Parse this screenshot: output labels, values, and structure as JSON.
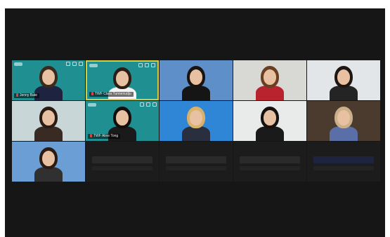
{
  "meeting": {
    "title": "",
    "participants": [
      {
        "id": "p1",
        "name": "Jenny Bate",
        "bg": "#1f8f91",
        "hair": "#3a2a1e",
        "top": "#1e2440",
        "has_name": true,
        "has_icons": true,
        "active": false
      },
      {
        "id": "p2",
        "name": "TWF Clara Tunnenudju",
        "bg": "#1f8f91",
        "hair": "#2a1e16",
        "top": "#f3f3f3",
        "has_name": true,
        "has_icons": true,
        "active": true
      },
      {
        "id": "p3",
        "name": "",
        "bg": "#5f8fc9",
        "hair": "#1a1410",
        "top": "#151515",
        "has_name": false,
        "has_icons": false,
        "active": false
      },
      {
        "id": "p4",
        "name": "",
        "bg": "#d8d8d4",
        "hair": "#6a3e22",
        "top": "#b8232e",
        "has_name": false,
        "has_icons": false,
        "active": false
      },
      {
        "id": "p5",
        "name": "",
        "bg": "#e3e6e8",
        "hair": "#1e1612",
        "top": "#242424",
        "has_name": false,
        "has_icons": false,
        "active": false
      },
      {
        "id": "p6",
        "name": "",
        "bg": "#c9d6d8",
        "hair": "#2a1c14",
        "top": "#3a2a24",
        "has_name": false,
        "has_icons": false,
        "active": false
      },
      {
        "id": "p7",
        "name": "TWF Aline Tong",
        "bg": "#1f8f91",
        "hair": "#120e0c",
        "top": "#1a1a1a",
        "has_name": true,
        "has_icons": true,
        "active": false
      },
      {
        "id": "p8",
        "name": "",
        "bg": "#2f86d6",
        "hair": "#d9b26a",
        "top": "#2a2f40",
        "has_name": false,
        "has_icons": false,
        "active": false
      },
      {
        "id": "p9",
        "name": "",
        "bg": "#e9eaea",
        "hair": "#161210",
        "top": "#1a1a1a",
        "has_name": false,
        "has_icons": false,
        "active": false
      },
      {
        "id": "p10",
        "name": "",
        "bg": "#4b3a2e",
        "hair": "#c8b08a",
        "top": "#5a6fa8",
        "has_name": false,
        "has_icons": false,
        "active": false
      },
      {
        "id": "p11",
        "name": "",
        "bg": "#6c9ed6",
        "hair": "#2a1c14",
        "top": "#303030",
        "has_name": false,
        "has_icons": false,
        "active": false
      }
    ],
    "placeholder_count": 4
  }
}
